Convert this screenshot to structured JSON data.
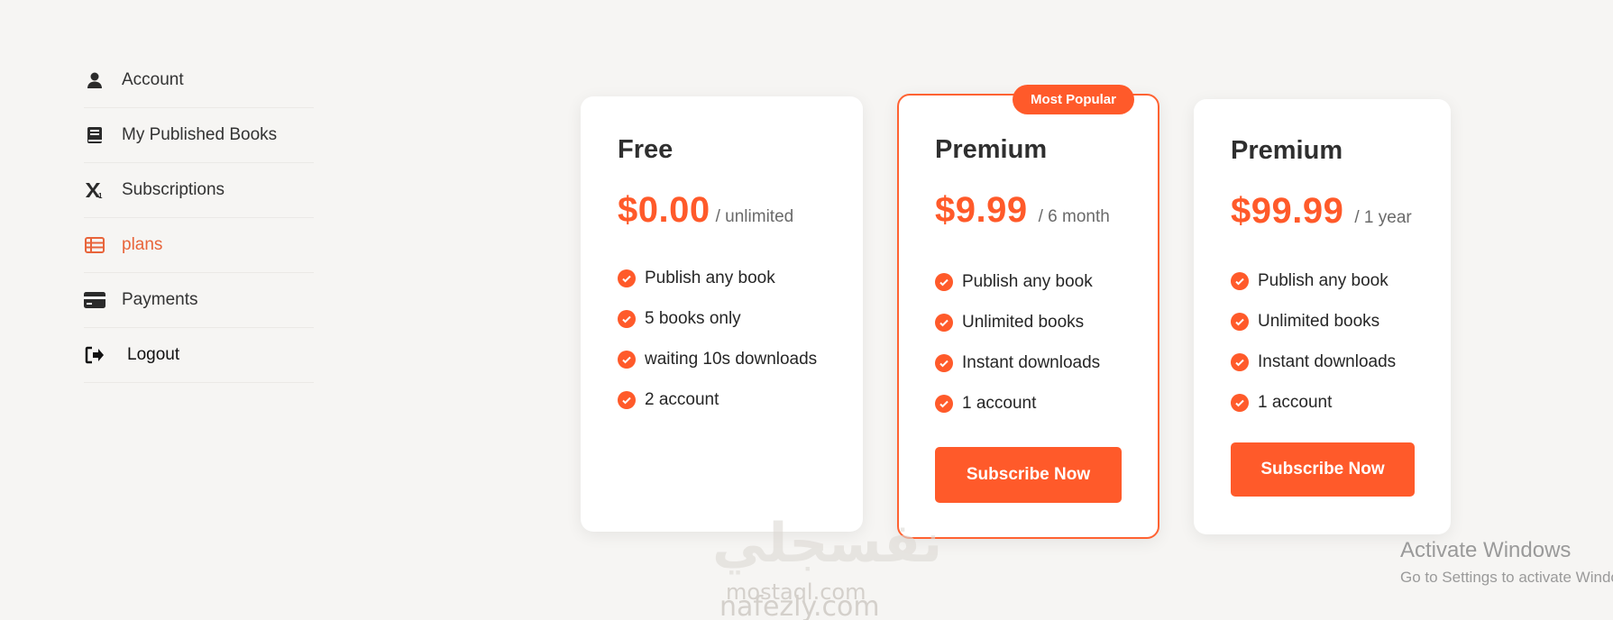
{
  "sidebar": {
    "items": [
      {
        "label": "Account",
        "icon": "user-icon"
      },
      {
        "label": "My Published Books",
        "icon": "book-icon"
      },
      {
        "label": "Subscriptions",
        "icon": "subscript-icon"
      },
      {
        "label": "plans",
        "icon": "table-list-icon",
        "active": true
      },
      {
        "label": "Payments",
        "icon": "credit-card-icon"
      },
      {
        "label": "Logout",
        "icon": "logout-icon"
      }
    ]
  },
  "plans": [
    {
      "name": "Free",
      "price": "$0.00",
      "period": "/ unlimited",
      "features": [
        "Publish any book",
        "5 books only",
        "waiting 10s downloads",
        "2 account"
      ]
    },
    {
      "name": "Premium",
      "badge": "Most Popular",
      "price": "$9.99",
      "period": "/ 6 month",
      "features": [
        "Publish any book",
        "Unlimited books",
        "Instant downloads",
        "1 account"
      ],
      "button": "Subscribe Now"
    },
    {
      "name": "Premium",
      "price": "$99.99",
      "period": "/ 1 year",
      "features": [
        "Publish any book",
        "Unlimited books",
        "Instant downloads",
        "1 account"
      ],
      "button": "Subscribe Now"
    }
  ],
  "watermark": {
    "arabic": "نفسجلي",
    "line1": "mostaql.com",
    "line2": "nafezly.com"
  },
  "windows_notice": {
    "title": "Activate Windows",
    "subtitle": "Go to Settings to activate Windows."
  },
  "colors": {
    "accent": "#ff5a2a",
    "background": "#f6f5f3"
  }
}
